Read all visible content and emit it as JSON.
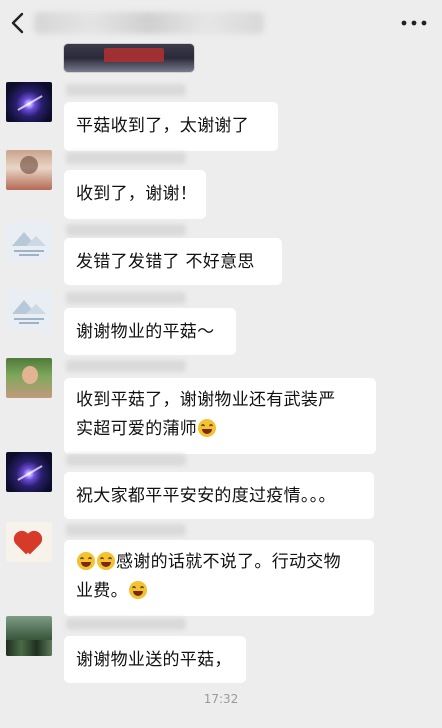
{
  "header": {
    "back_icon": "chevron-left-icon",
    "more_icon": "more-dots-icon"
  },
  "messages": [
    {
      "avatar": "space",
      "lines": [
        "平菇收到了，太谢谢了"
      ]
    },
    {
      "avatar": "family",
      "lines": [
        "收到了，谢谢！"
      ]
    },
    {
      "avatar": "mountain",
      "lines": [
        "发错了发错了 不好意思"
      ]
    },
    {
      "avatar": "mountain",
      "lines": [
        "谢谢物业的平菇～"
      ]
    },
    {
      "avatar": "woman",
      "lines": [
        "收到平菇了，谢谢物业还有武装严",
        "实超可爱的蒲师"
      ]
    },
    {
      "avatar": "space",
      "lines": [
        "祝大家都平平安安的度过疫情。。。"
      ]
    },
    {
      "avatar": "heart",
      "lines": [
        "感谢的话就不说了。行动交物",
        "业费。"
      ]
    },
    {
      "avatar": "trees",
      "lines": [
        "谢谢物业送的平菇，"
      ]
    }
  ],
  "timestamp": "17:32",
  "colors": {
    "background": "#ededed",
    "bubble": "#ffffff",
    "timestamp": "#9a9a9a"
  }
}
